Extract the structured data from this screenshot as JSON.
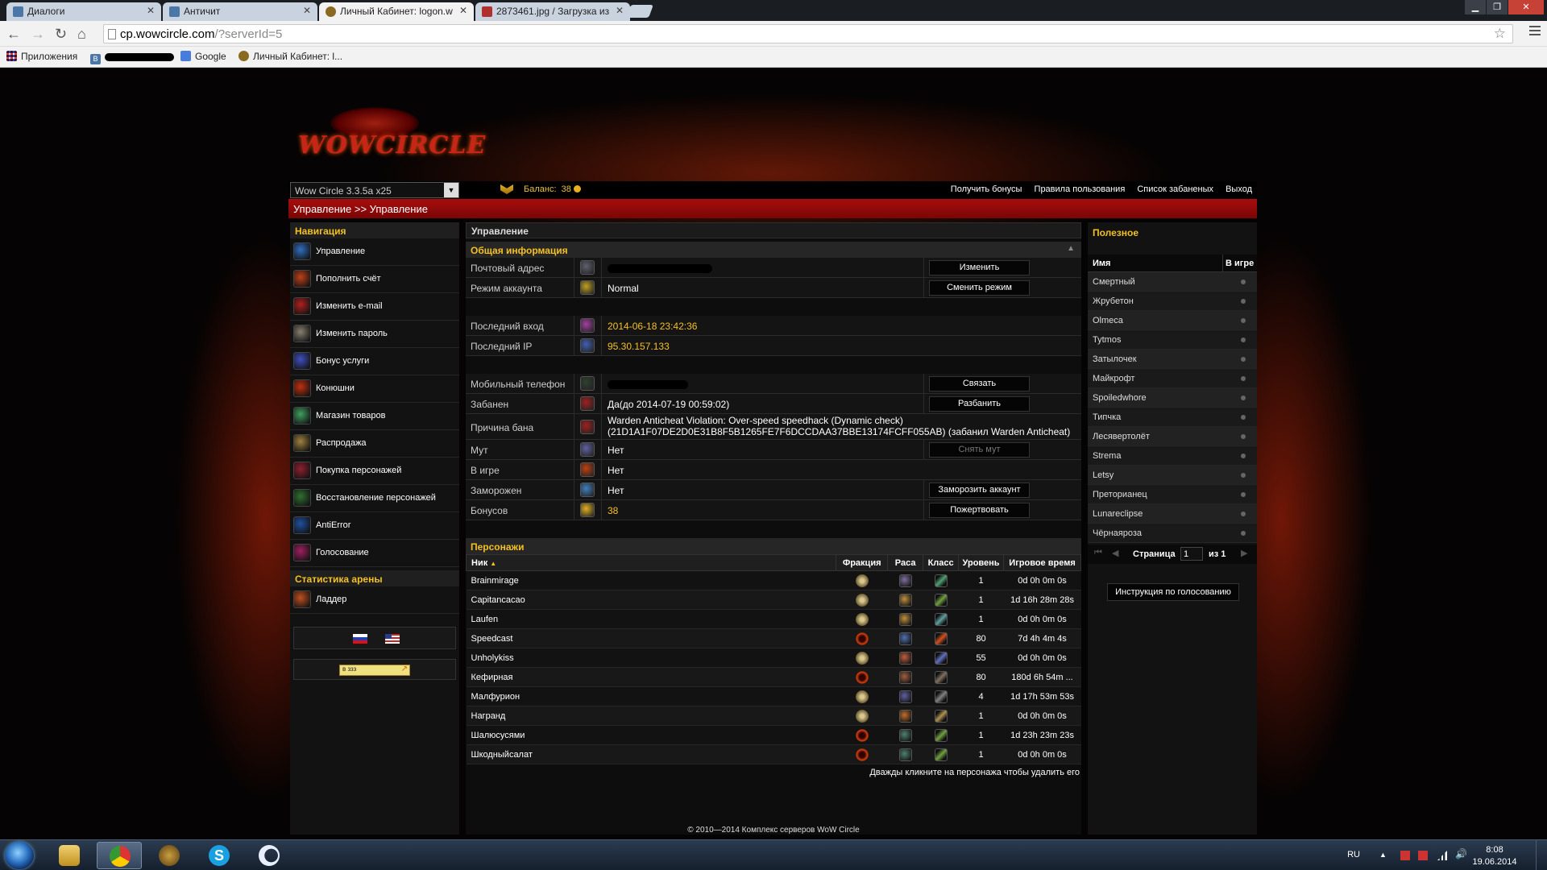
{
  "browser": {
    "tabs": [
      {
        "title": "Диалоги",
        "active": false
      },
      {
        "title": "Античит",
        "active": false
      },
      {
        "title": "Личный Кабинет: logon.w",
        "active": true
      },
      {
        "title": "2873461.jpg / Загрузка из",
        "active": false
      }
    ],
    "url_host": "cp.wowcircle.com",
    "url_path": "/?serverId=5",
    "bookmarks": {
      "apps": "Приложения",
      "b2": "Google",
      "b3": "Личный Кабинет: l..."
    }
  },
  "header": {
    "logo_text": "WOWCIRCLE",
    "server_select": "Wow Circle 3.3.5a x25",
    "balance_label": "Баланс:",
    "balance_value": "38",
    "links": [
      "Получить бонусы",
      "Правила пользования",
      "Список забаненых",
      "Выход"
    ],
    "breadcrumb": "Управление >> Управление"
  },
  "nav": {
    "title": "Навигация",
    "items": [
      {
        "label": "Управление",
        "icon": "management-icon",
        "color": "#2f6fc0"
      },
      {
        "label": "Пополнить счёт",
        "icon": "deposit-icon",
        "color": "#c0401a"
      },
      {
        "label": "Изменить e-mail",
        "icon": "email-change-icon",
        "color": "#b02020"
      },
      {
        "label": "Изменить пароль",
        "icon": "password-change-icon",
        "color": "#888070"
      },
      {
        "label": "Бонус услуги",
        "icon": "bonus-services-icon",
        "color": "#4050c0"
      },
      {
        "label": "Конюшни",
        "icon": "stables-icon",
        "color": "#c03010"
      },
      {
        "label": "Магазин товаров",
        "icon": "shop-icon",
        "color": "#40a060"
      },
      {
        "label": "Распродажа",
        "icon": "sale-icon",
        "color": "#a08040"
      },
      {
        "label": "Покупка персонажей",
        "icon": "buy-characters-icon",
        "color": "#902030"
      },
      {
        "label": "Восстановление персонажей",
        "icon": "restore-characters-icon",
        "color": "#307030"
      },
      {
        "label": "AntiError",
        "icon": "antierror-icon",
        "color": "#2050a0"
      },
      {
        "label": "Голосование",
        "icon": "voting-icon",
        "color": "#a02060"
      }
    ],
    "arena_title": "Статистика арены",
    "arena_items": [
      {
        "label": "Ладдер",
        "icon": "ladder-icon",
        "color": "#c05020"
      }
    ],
    "vote_banner": "в ззз"
  },
  "main": {
    "panel_title": "Управление",
    "general_title": "Общая информация",
    "group1": [
      {
        "label": "Почтовый адрес",
        "icon": "mail-icon",
        "color": "#606070",
        "value": "",
        "redacted": true,
        "button": "Изменить"
      },
      {
        "label": "Режим аккаунта",
        "icon": "account-mode-star-icon",
        "color": "#c0a020",
        "value": "Normal",
        "button": "Сменить режим"
      }
    ],
    "group2": [
      {
        "label": "Последний вход",
        "icon": "last-login-icon",
        "color": "#a040a0",
        "value": "2014-06-18 23:42:36",
        "gold": true
      },
      {
        "label": "Последний IP",
        "icon": "last-ip-icon",
        "color": "#4060b0",
        "value": "95.30.157.133",
        "gold": true
      }
    ],
    "group3": [
      {
        "label": "Мобильный телефон",
        "icon": "mobile-phone-icon",
        "color": "#304030",
        "value": "",
        "redacted": true,
        "button": "Связать"
      },
      {
        "label": "Забанен",
        "icon": "banned-icon",
        "color": "#a02020",
        "value": "Да(до 2014-07-19 00:59:02)",
        "button": "Разбанить"
      },
      {
        "label": "Причина бана",
        "icon": "ban-reason-icon",
        "color": "#a02020",
        "value": "Warden Anticheat Violation: Over-speed speedhack (Dynamic check) (21D1A1F07DE2D0E31B8F5B1265FE7F6DCCDAA37BBE13174FCFF055AB) (забанил Warden Anticheat)",
        "tall": true
      },
      {
        "label": "Мут",
        "icon": "mute-icon",
        "color": "#6060a0",
        "value": "Нет",
        "button": "Снять мут",
        "disabled": true
      },
      {
        "label": "В игре",
        "icon": "in-game-icon",
        "color": "#c04010",
        "value": "Нет"
      },
      {
        "label": "Заморожен",
        "icon": "frozen-icon",
        "color": "#4080c0",
        "value": "Нет",
        "button": "Заморозить аккаунт"
      },
      {
        "label": "Бонусов",
        "icon": "bonus-coin-icon",
        "color": "#e0b020",
        "value": "38",
        "gold": true,
        "button": "Пожертвовать"
      }
    ],
    "characters_title": "Персонажи",
    "columns": [
      "Ник",
      "Фракция",
      "Раса",
      "Класс",
      "Уровень",
      "Игровое время"
    ],
    "characters": [
      {
        "nick": "Brainmirage",
        "faction": "alliance",
        "race_color": "#8070a0",
        "class_color": "#50a070",
        "level": "1",
        "time": "0d 0h 0m 0s"
      },
      {
        "nick": "Capitancacao",
        "faction": "alliance",
        "race_color": "#c09040",
        "class_color": "#70a040",
        "level": "1",
        "time": "1d 16h 28m 28s"
      },
      {
        "nick": "Laufen",
        "faction": "alliance",
        "race_color": "#c09040",
        "class_color": "#60a0a0",
        "level": "1",
        "time": "0d 0h 0m 0s"
      },
      {
        "nick": "Speedcast",
        "faction": "horde",
        "race_color": "#5070b0",
        "class_color": "#d05020",
        "level": "80",
        "time": "7d 4h 4m 4s"
      },
      {
        "nick": "Unholykiss",
        "faction": "alliance",
        "race_color": "#c06040",
        "class_color": "#6070c0",
        "level": "55",
        "time": "0d 0h 0m 0s"
      },
      {
        "nick": "Кефирная",
        "faction": "horde",
        "race_color": "#a06040",
        "class_color": "#807060",
        "level": "80",
        "time": "180d 6h 54m ..."
      },
      {
        "nick": "Малфурион",
        "faction": "alliance",
        "race_color": "#6060a0",
        "class_color": "#808080",
        "level": "4",
        "time": "1d 17h 53m 53s"
      },
      {
        "nick": "Награнд",
        "faction": "alliance",
        "race_color": "#c07030",
        "class_color": "#b09050",
        "level": "1",
        "time": "0d 0h 0m 0s"
      },
      {
        "nick": "Шалюсусями",
        "faction": "horde",
        "race_color": "#508070",
        "class_color": "#70a040",
        "level": "1",
        "time": "1d 23h 23m 23s"
      },
      {
        "nick": "Шкодныйсалат",
        "faction": "horde",
        "race_color": "#508070",
        "class_color": "#70a040",
        "level": "1",
        "time": "0d 0h 0m 0s"
      }
    ],
    "hint": "Дважды кликните на персонажа чтобы удалить его"
  },
  "side": {
    "title": "Полезное",
    "col_name": "Имя",
    "col_ingame": "В игре",
    "players": [
      "Смертный",
      "Жрубетон",
      "Olmeca",
      "Tytmos",
      "Затылочек",
      "Майкрофт",
      "Spoiledwhore",
      "Типчка",
      "Лесявертолёт",
      "Strema",
      "Letsy",
      "Преторианец",
      "Lunareclipse",
      "Чёрнаяроза"
    ],
    "page_label": "Страница",
    "page_value": "1",
    "page_of": "из 1",
    "vote_button": "Инструкция по голосованию"
  },
  "footer": "© 2010—2014 Комплекс серверов WoW Circle",
  "taskbar": {
    "lang": "RU",
    "time": "8:08",
    "date": "19.06.2014"
  },
  "colors": {
    "accent_gold": "#f5c022",
    "header_red": "#a80d0d"
  }
}
